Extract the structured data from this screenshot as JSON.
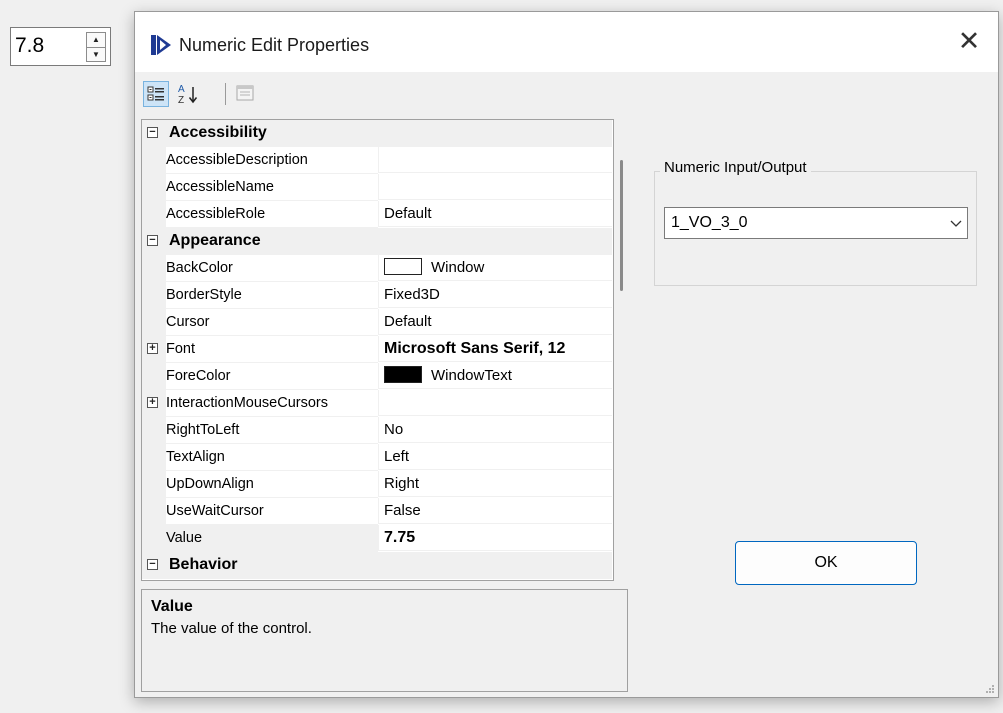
{
  "numeric_edit": {
    "value": "7.8"
  },
  "dialog": {
    "title": "Numeric Edit Properties",
    "close_glyph": "✕"
  },
  "property_grid": {
    "rows": [
      {
        "kind": "category",
        "label": "Accessibility",
        "expander": "minus"
      },
      {
        "kind": "property",
        "name": "AccessibleDescription",
        "value": ""
      },
      {
        "kind": "property",
        "name": "AccessibleName",
        "value": ""
      },
      {
        "kind": "property",
        "name": "AccessibleRole",
        "value": "Default"
      },
      {
        "kind": "category",
        "label": "Appearance",
        "expander": "minus"
      },
      {
        "kind": "property",
        "name": "BackColor",
        "value": "Window",
        "swatch": "#ffffff"
      },
      {
        "kind": "property",
        "name": "BorderStyle",
        "value": "Fixed3D"
      },
      {
        "kind": "property",
        "name": "Cursor",
        "value": "Default"
      },
      {
        "kind": "property",
        "name": "Font",
        "value": "Microsoft Sans Serif, 12",
        "expander": "plus",
        "bold": true
      },
      {
        "kind": "property",
        "name": "ForeColor",
        "value": "WindowText",
        "swatch": "#000000"
      },
      {
        "kind": "property",
        "name": "InteractionMouseCursors",
        "value": "",
        "expander": "plus"
      },
      {
        "kind": "property",
        "name": "RightToLeft",
        "value": "No"
      },
      {
        "kind": "property",
        "name": "TextAlign",
        "value": "Left"
      },
      {
        "kind": "property",
        "name": "UpDownAlign",
        "value": "Right"
      },
      {
        "kind": "property",
        "name": "UseWaitCursor",
        "value": "False"
      },
      {
        "kind": "property",
        "name": "Value",
        "value": "7.75",
        "bold": true,
        "selected": true
      },
      {
        "kind": "category",
        "label": "Behavior",
        "expander": "minus"
      }
    ]
  },
  "help": {
    "title": "Value",
    "description": "The value of the control."
  },
  "group": {
    "legend": "Numeric Input/Output",
    "combo_value": "1_VO_3_0"
  },
  "ok_label": "OK",
  "colors": {
    "accent": "#0067c0",
    "selection": "#cde4f7",
    "app_icon": "#1f3a93"
  }
}
